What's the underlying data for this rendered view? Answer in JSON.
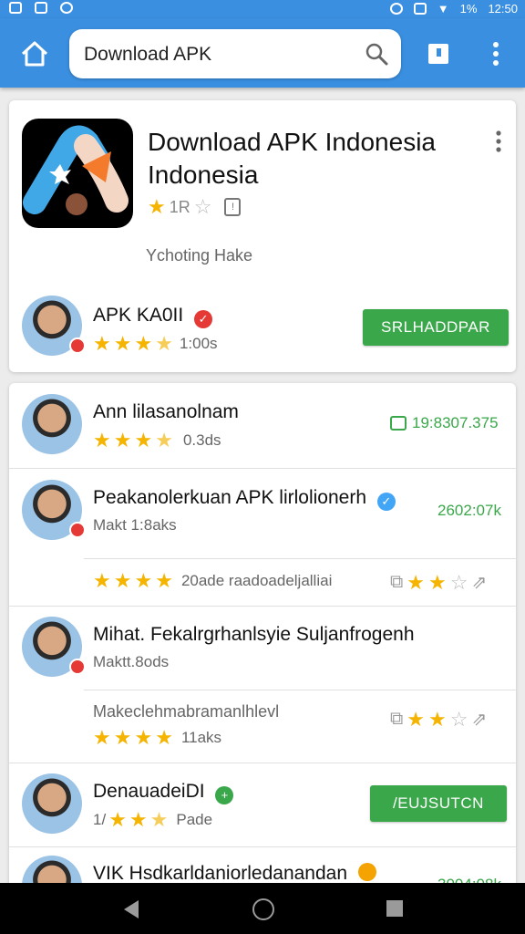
{
  "status_bar": {
    "battery": "1%",
    "time": "12:50"
  },
  "search": {
    "query": "Download APK"
  },
  "app": {
    "title_line1": "Download APK Indonesia",
    "title_line2": "Indonesia",
    "rating_text": "1R",
    "developer": "Ychoting Hake"
  },
  "featured": {
    "name": "APK KA0II",
    "rating_text": "1:00s",
    "button_label": "SRLHADDPAR"
  },
  "rows": [
    {
      "name": "Ann lilasanolnam",
      "sub": "0.3ds",
      "meta": "19:8307.375"
    },
    {
      "name": "Peakanolerkuan APK lirlolionerh",
      "sub": "Makt 1:8aks",
      "meta": "2602:07k",
      "rating_text": "20ade raadoadeljalliai"
    },
    {
      "name": "Mihat. Fekalrgrhanlsyie Suljanfrogenh",
      "sub": "Maktt.8ods",
      "extra": "Makeclehmabramanlhlevl",
      "rating_text": "11aks"
    },
    {
      "name": "DenauadeiDI",
      "sub": "Pade",
      "sub_prefix": "1/",
      "button_label": "/EUJSUTCN"
    },
    {
      "name": "VIK Hsdkarldaniorledanandan",
      "meta": "3004:08k"
    }
  ],
  "colors": {
    "accent": "#3a8fe0",
    "green": "#3aa74a",
    "star": "#f4b400"
  }
}
